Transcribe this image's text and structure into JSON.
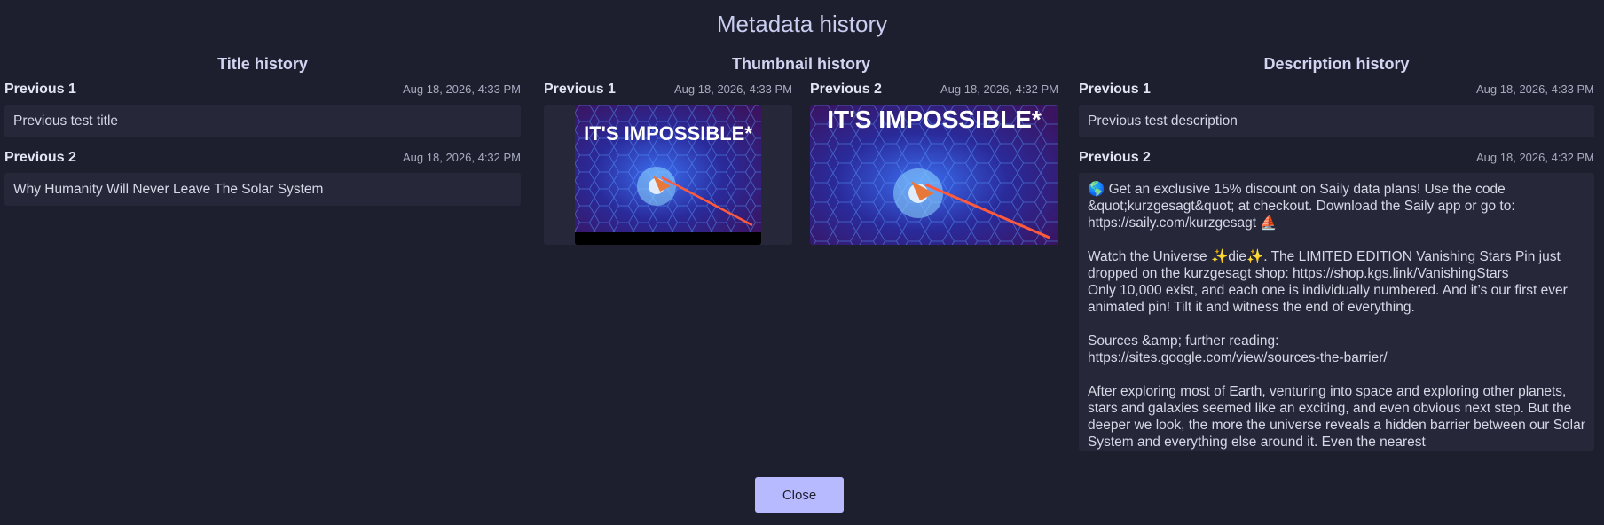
{
  "dialog": {
    "title": "Metadata history",
    "close_label": "Close"
  },
  "title_history": {
    "heading": "Title history",
    "entries": [
      {
        "label": "Previous 1",
        "time": "Aug 18, 2026, 4:33 PM",
        "value": "Previous test title"
      },
      {
        "label": "Previous 2",
        "time": "Aug 18, 2026, 4:32 PM",
        "value": "Why Humanity Will Never Leave The Solar System"
      }
    ]
  },
  "thumbnail_history": {
    "heading": "Thumbnail history",
    "entries": [
      {
        "label": "Previous 1",
        "time": "Aug 18, 2026, 4:33 PM",
        "image_text": "IT'S IMPOSSIBLE*"
      },
      {
        "label": "Previous 2",
        "time": "Aug 18, 2026, 4:32 PM",
        "image_text": "IT'S IMPOSSIBLE*"
      }
    ]
  },
  "description_history": {
    "heading": "Description history",
    "entries": [
      {
        "label": "Previous 1",
        "time": "Aug 18, 2026, 4:33 PM",
        "value": "Previous test description"
      },
      {
        "label": "Previous 2",
        "time": "Aug 18, 2026, 4:32 PM",
        "paragraphs": [
          "🌎 Get an exclusive 15% discount on Saily data plans! Use the code &quot;kurzgesagt&quot; at checkout. Download the Saily app or go to: https://saily.com/kurzgesagt ⛵",
          "Watch the Universe ✨die✨. The LIMITED EDITION Vanishing Stars Pin just dropped on the kurzgesagt shop: https://shop.kgs.link/VanishingStars\nOnly 10,000 exist, and each one is individually numbered. And it’s our first ever animated pin! Tilt it and witness the end of everything.",
          "Sources &amp; further reading:\nhttps://sites.google.com/view/sources-the-barrier/",
          "After exploring most of Earth, venturing into space and exploring other planets, stars and galaxies seemed like an exciting, and even obvious next step. But the deeper we look, the more the universe reveals a hidden barrier between our Solar System and everything else around it. Even the nearest"
        ]
      }
    ]
  },
  "colors": {
    "background": "#1e1f2e",
    "panel": "#26283a",
    "accent": "#b8baff"
  }
}
